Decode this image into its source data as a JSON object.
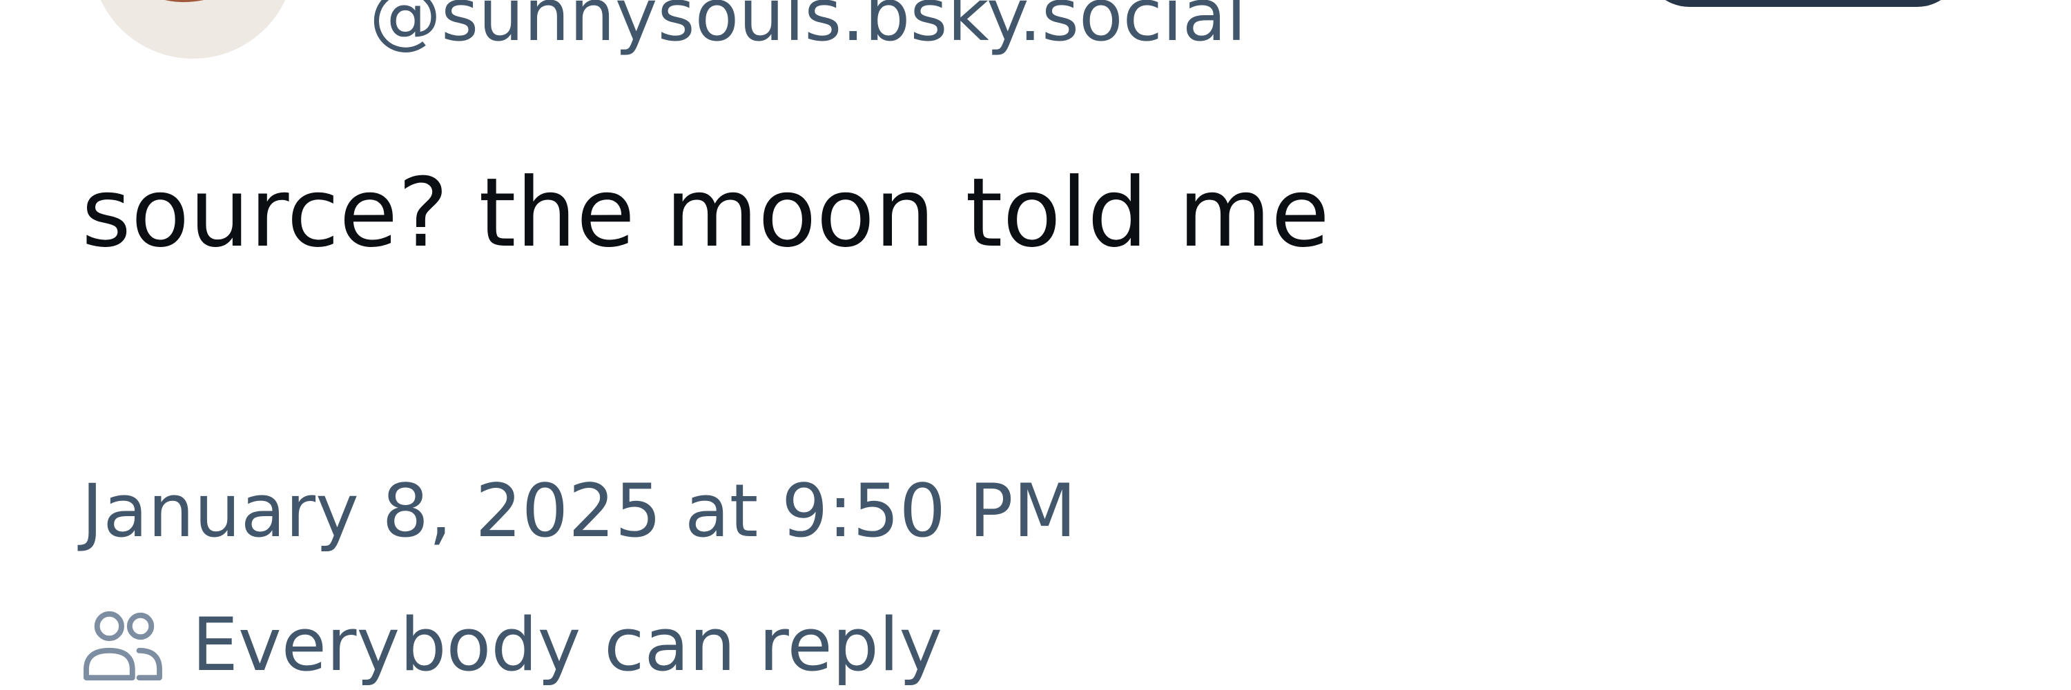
{
  "author": {
    "handle": "@sunnysouls.bsky.social"
  },
  "post": {
    "text": "source? the moon told me",
    "timestamp": "January 8, 2025 at 9:50 PM"
  },
  "reply_setting": {
    "icon": "people-icon",
    "label": "Everybody can reply"
  },
  "colors": {
    "secondary_text": "#42576c",
    "primary_text": "#0b0f14",
    "button_bg": "#263648"
  }
}
